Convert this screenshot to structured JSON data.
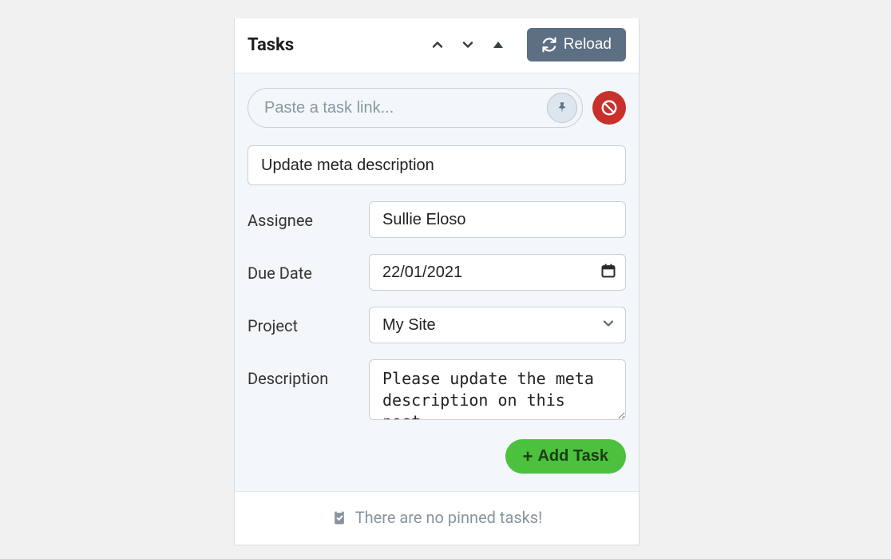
{
  "header": {
    "title": "Tasks",
    "reload_label": "Reload"
  },
  "link_row": {
    "placeholder": "Paste a task link..."
  },
  "form": {
    "title_value": "Update meta description",
    "assignee_label": "Assignee",
    "assignee_value": "Sullie Eloso",
    "due_date_label": "Due Date",
    "due_date_value": "22/01/2021",
    "project_label": "Project",
    "project_value": "My Site",
    "description_label": "Description",
    "description_value": "Please update the meta description on this post",
    "add_task_label": "Add Task"
  },
  "footer": {
    "empty_text": "There are no pinned tasks!"
  },
  "icons": {
    "chevron_up": "chevron-up-icon",
    "chevron_down": "chevron-down-icon",
    "collapse_up": "caret-up-icon",
    "reload": "reload-icon",
    "pin": "pin-icon",
    "cancel": "prohibited-icon",
    "calendar": "calendar-icon",
    "dropdown": "chevron-down-icon",
    "clipboard": "clipboard-check-icon",
    "plus": "plus-icon"
  }
}
